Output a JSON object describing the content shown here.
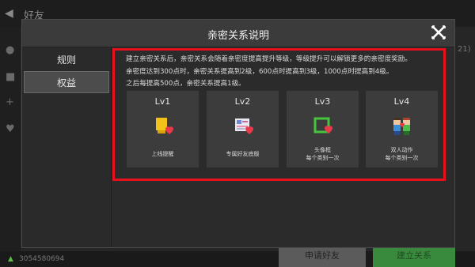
{
  "background": {
    "back_icon": "back-icon",
    "title": "好友",
    "side_count": "21)",
    "device_id": "3054580694",
    "blurred_name": "",
    "button_left": "申请好友",
    "button_right": "建立关系"
  },
  "dialog": {
    "title": "亲密关系说明",
    "close_icon": "close-icon",
    "tabs": [
      {
        "label": "规则"
      },
      {
        "label": "权益"
      }
    ],
    "description": [
      "建立亲密关系后，亲密关系会随着亲密度提高提升等级，等级提升可以解锁更多的亲密度奖励。",
      "亲密度达到300点时，亲密关系提高到2级，600点时提高到3级，1000点时提高到4级。",
      "之后每提高500点，亲密关系提高1级。"
    ],
    "levels": [
      {
        "level": "Lv1",
        "icon": "online-reminder-icon",
        "caption": "上线提醒",
        "caption2": ""
      },
      {
        "level": "Lv2",
        "icon": "friend-base-icon",
        "caption": "专属好友底版",
        "caption2": ""
      },
      {
        "level": "Lv3",
        "icon": "avatar-frame-icon",
        "caption": "头像框",
        "caption2": "每个类别一次"
      },
      {
        "level": "Lv4",
        "icon": "duo-action-icon",
        "caption": "双人动作",
        "caption2": "每个类别一次"
      }
    ]
  },
  "colors": {
    "highlight": "#e8101c",
    "heart": "#e83a4a"
  }
}
